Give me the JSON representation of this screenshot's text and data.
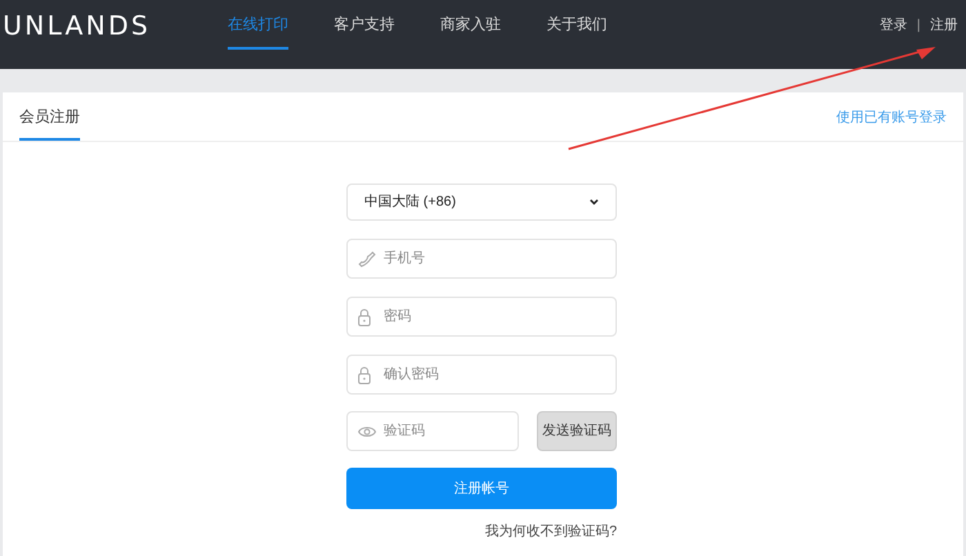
{
  "header": {
    "logo": "UNLANDS",
    "nav": [
      {
        "label": "在线打印",
        "selected": true
      },
      {
        "label": "客户支持",
        "selected": false
      },
      {
        "label": "商家入驻",
        "selected": false
      },
      {
        "label": "关于我们",
        "selected": false
      }
    ],
    "account": {
      "login": "登录",
      "separator": "|",
      "register": "注册"
    }
  },
  "card": {
    "tabs": [
      {
        "label": "会员注册",
        "selected": true
      }
    ],
    "switch_link": "使用已有账号登录",
    "form": {
      "region": "中国大陆 (+86)",
      "fields": [
        {
          "kind": "phone",
          "placeholder": "手机号"
        },
        {
          "kind": "lock",
          "placeholder": "密码"
        },
        {
          "kind": "lock",
          "placeholder": "确认密码"
        }
      ],
      "code": {
        "kind": "eye",
        "placeholder": "验证码"
      },
      "send_code": "发送验证码",
      "submit": "注册帐号",
      "help_link": "我为何收不到验证码?"
    }
  }
}
